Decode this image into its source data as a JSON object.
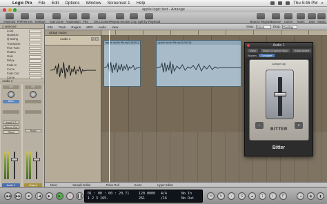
{
  "menubar": {
    "app": "Logic Pro",
    "items": [
      "File",
      "Edit",
      "Options",
      "Window",
      "Screenset 1",
      "Help"
    ],
    "clock": "Thu 5:46 PM"
  },
  "window": {
    "title": "apple logic test - Arrange"
  },
  "toolbar": {
    "left": [
      "Inspector",
      "Preferences",
      "Settings"
    ],
    "center": [
      "Auto Zoom",
      "Automation",
      "Flex",
      "Set Locators",
      "Repeat Section",
      "Crop",
      "Split by Playhead"
    ],
    "right": [
      "Bounce Regions",
      "Bounce",
      "Colors",
      "Notes",
      "Lists",
      "Media"
    ]
  },
  "inspector": {
    "header": "2 selected",
    "params": [
      "Loop",
      "Quantize",
      "Q-Swing",
      "Transpose",
      "Fine Tune",
      "Flatten",
      "Gain",
      "Delay",
      "Fade In",
      "Curve",
      "Fade Out",
      "Curve",
      "Follow Tempo"
    ],
    "audio_header": "Audio 1",
    "strip1": {
      "slots": [
        "I/O",
        "Bitter",
        "Input 1-2",
        "Stereo Out",
        "Read"
      ],
      "name": "Audio 1"
    },
    "strip2": {
      "slots": [
        "I/O",
        "",
        "",
        "",
        "Read"
      ],
      "name": "Output"
    }
  },
  "arrange": {
    "menus": [
      "Edit",
      "Track",
      "Region",
      "MIDI",
      "Audio",
      "View"
    ],
    "snap_label": "Snap:",
    "snap_value": "Smart",
    "drag_label": "Drag:",
    "drag_value": "Overlap",
    "global_tracks": "Global Tracks",
    "track_name": "Audio 1",
    "regions": [
      "apple audio file.mp3 (5#11)",
      "apple audio file.mp3 (5#19)"
    ]
  },
  "plugin": {
    "title": "Audio 1",
    "bar_items": [
      "View",
      "Vision Channel Strip",
      "Show Insert"
    ],
    "bypass": "Bypass",
    "compare": "Compare",
    "brand": "BITTER",
    "name": "Bitter",
    "face_header": "sample clip",
    "left_button": "L",
    "right_button": "R"
  },
  "tabs": [
    "Mixer",
    "Sample Editor",
    "Piano Roll",
    "Score",
    "Hyper Editor"
  ],
  "transport": {
    "smpte": "01 : 00 : 00 : 20.71",
    "bars": "1 2 3 165.",
    "tempo": "120.0000",
    "tempo_sub": "261",
    "sig": "4/4",
    "div": "/16",
    "in": "No In",
    "out": "No Out",
    "buttons": [
      "rewind",
      "forward",
      "stop",
      "play",
      "record",
      "pause",
      "cycle"
    ]
  }
}
